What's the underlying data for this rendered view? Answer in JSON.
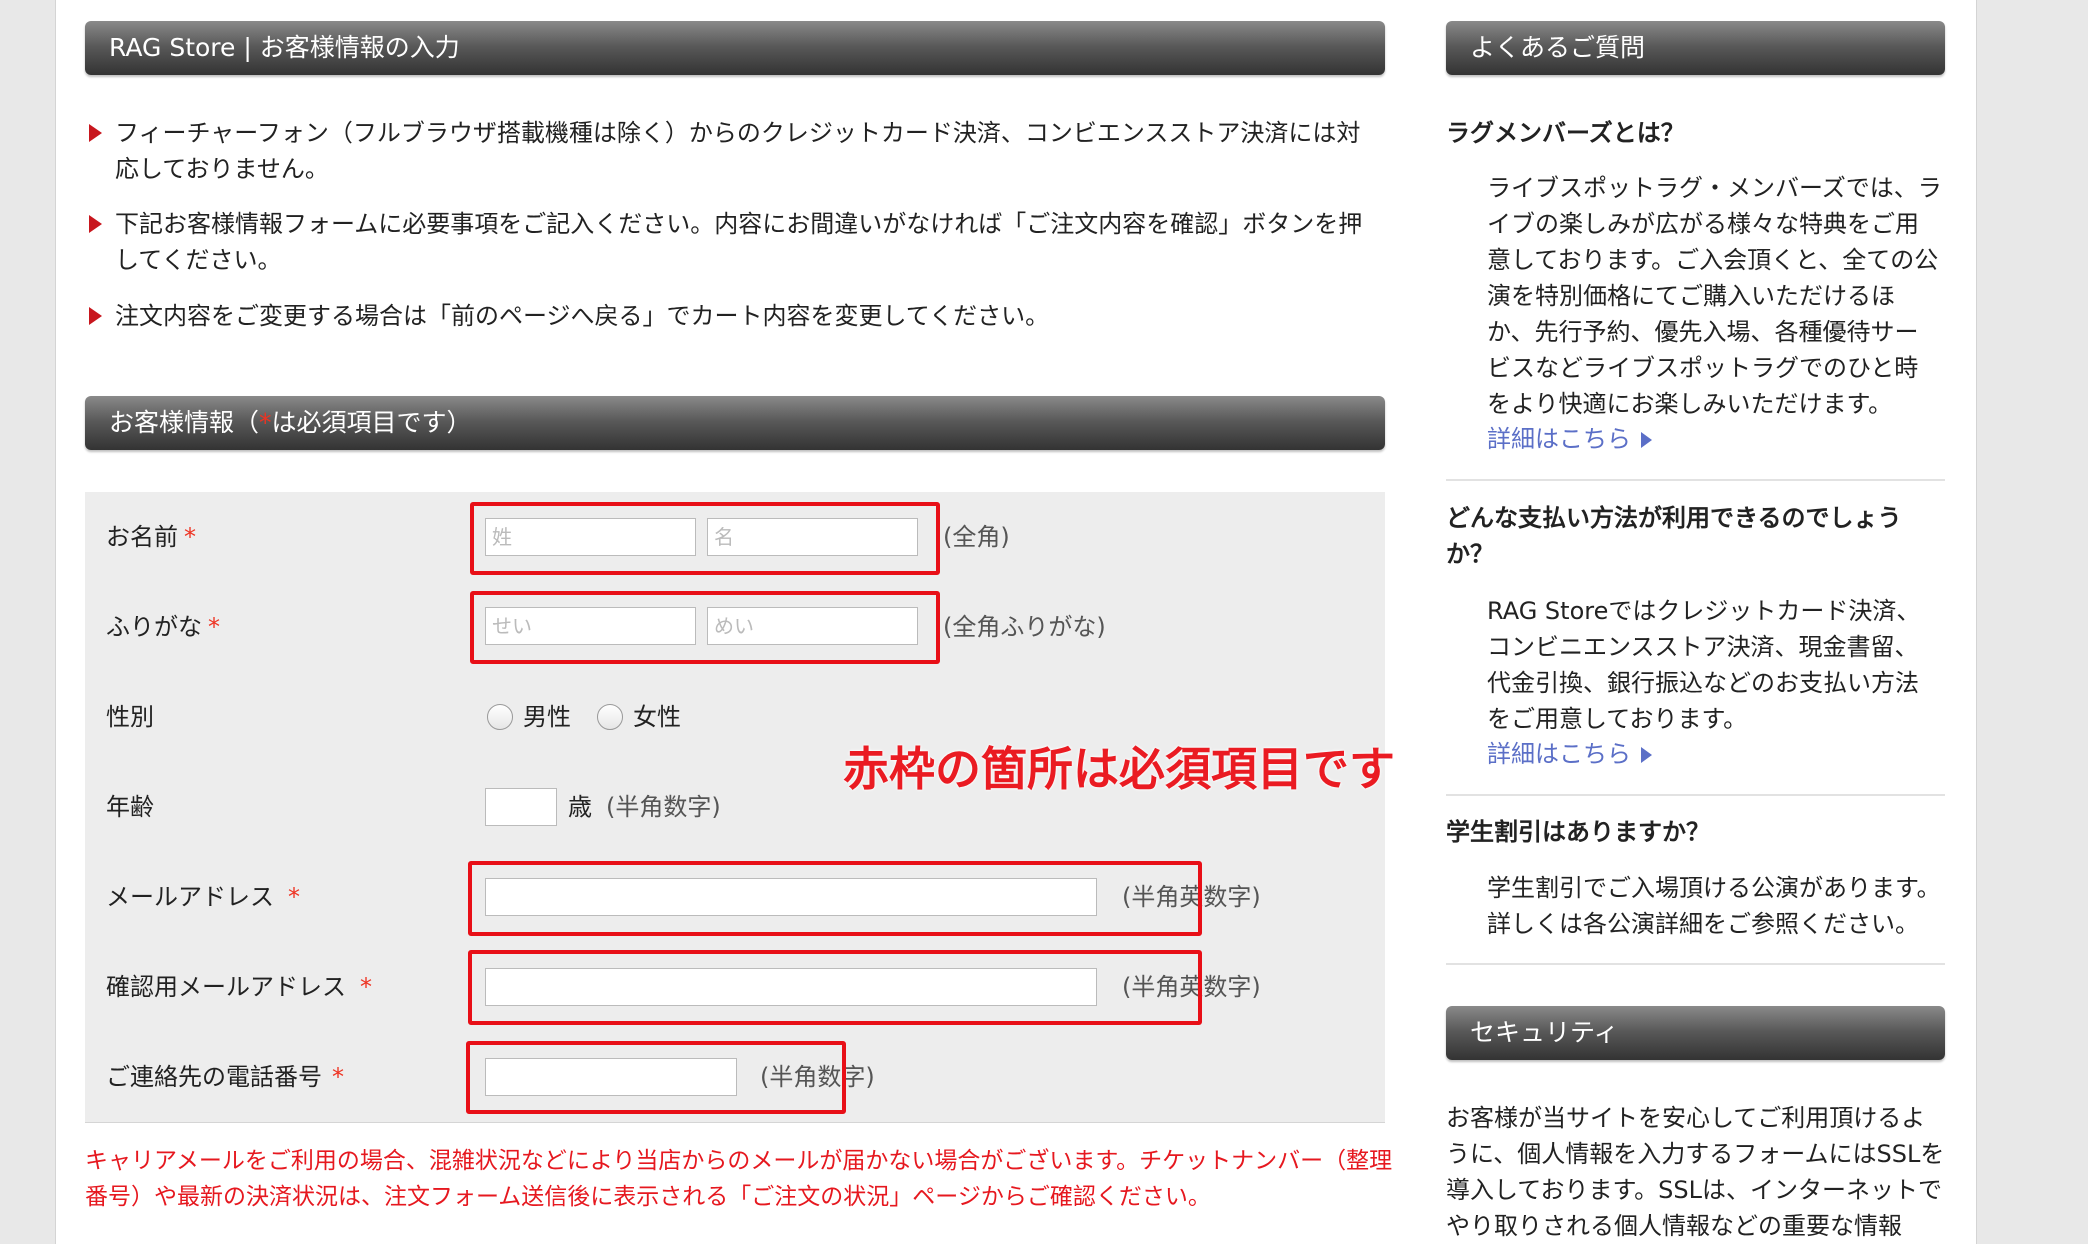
{
  "main": {
    "title": "RAG Store | お客様情報の入力",
    "notices": [
      "フィーチャーフォン（フルブラウザ搭載機種は除く）からのクレジットカード決済、コンビエンスストア決済には対応しておりません。",
      "下記お客様情報フォームに必要事項をご記入ください。内容にお間違いがなければ「ご注文内容を確認」ボタンを押してください。",
      "注文内容をご変更する場合は「前のページへ戻る」でカート内容を変更してください。"
    ],
    "customer_section": {
      "title_prefix": "お客様情報（",
      "title_star": "*",
      "title_suffix": "は必須項目です）"
    }
  },
  "form": {
    "required_mark": "*",
    "name": {
      "label": "お名前",
      "last_placeholder": "姓",
      "first_placeholder": "名",
      "note": "(全角)"
    },
    "furigana": {
      "label": "ふりがな",
      "last_placeholder": "せい",
      "first_placeholder": "めい",
      "note": "(全角ふりがな)"
    },
    "gender": {
      "label": "性別",
      "male": "男性",
      "female": "女性"
    },
    "age": {
      "label": "年齢",
      "unit": "歳",
      "note": "(半角数字)"
    },
    "email": {
      "label": "メールアドレス",
      "note": "(半角英数字)"
    },
    "email_confirm": {
      "label": "確認用メールアドレス",
      "note": "(半角英数字)"
    },
    "phone": {
      "label": "ご連絡先の電話番号",
      "note": "(半角数字)"
    },
    "callout": "赤枠の箇所は必須項目です",
    "warning": "キャリアメールをご利用の場合、混雑状況などにより当店からのメールが届かない場合がございます。チケットナンバー（整理番号）や最新の決済状況は、注文フォーム送信後に表示される「ご注文の状況」ページからご確認ください。"
  },
  "sidebar": {
    "faq_title": "よくあるご質問",
    "faqs": [
      {
        "q": "ラグメンバーズとは？",
        "a": "ライブスポットラグ・メンバーズでは、ライブの楽しみが広がる様々な特典をご用意しております。ご入会頂くと、全ての公演を特別価格にてご購入いただけるほか、先行予約、優先入場、各種優待サービスなどライブスポットラグでのひと時をより快適にお楽しみいただけます。",
        "link": "詳細はこちら"
      },
      {
        "q": "どんな支払い方法が利用できるのでしょうか？",
        "a": "RAG Storeではクレジットカード決済、コンビニエンスストア決済、現金書留、代金引換、銀行振込などのお支払い方法をご用意しております。",
        "link": "詳細はこちら"
      },
      {
        "q": "学生割引はありますか？",
        "a": "学生割引でご入場頂ける公演があります。詳しくは各公演詳細をご参照ください。"
      }
    ],
    "security_title": "セキュリティ",
    "security_text": "お客様が当サイトを安心してご利用頂けるように、個人情報を入力するフォームにはSSLを導入しております。SSLは、インターネットでやり取りされる個人情報などの重要な情報"
  },
  "colors": {
    "required_red": "#e80f17",
    "link_blue": "#5b6fc7",
    "row_gray": "#ededed"
  }
}
